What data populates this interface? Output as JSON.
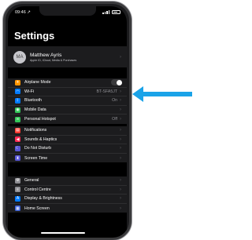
{
  "status": {
    "time": "09:46 ↗"
  },
  "title": "Settings",
  "profile": {
    "initials": "MA",
    "name": "Matthew Ayris",
    "subtitle": "Apple ID, iCloud, Media & Purchases"
  },
  "group1": [
    {
      "label": "Airplane Mode",
      "icon": "airplane-icon",
      "color": "#ff9500",
      "glyph": "✈",
      "toggle": true
    },
    {
      "label": "Wi-Fi",
      "icon": "wifi-icon",
      "color": "#007aff",
      "glyph": "◠",
      "value": "BT-SFA5JT"
    },
    {
      "label": "Bluetooth",
      "icon": "bluetooth-icon",
      "color": "#007aff",
      "glyph": "ᛒ",
      "value": "On"
    },
    {
      "label": "Mobile Data",
      "icon": "antenna-icon",
      "color": "#34c759",
      "glyph": "◉"
    },
    {
      "label": "Personal Hotspot",
      "icon": "hotspot-icon",
      "color": "#34c759",
      "glyph": "∞",
      "value": "Off"
    }
  ],
  "group2": [
    {
      "label": "Notifications",
      "icon": "bell-icon",
      "color": "#ff3b30",
      "glyph": "▤"
    },
    {
      "label": "Sounds & Haptics",
      "icon": "speaker-icon",
      "color": "#ff2d55",
      "glyph": "◀"
    },
    {
      "label": "Do Not Disturb",
      "icon": "moon-icon",
      "color": "#5856d6",
      "glyph": "☾"
    },
    {
      "label": "Screen Time",
      "icon": "hourglass-icon",
      "color": "#5856d6",
      "glyph": "⧗"
    }
  ],
  "group3": [
    {
      "label": "General",
      "icon": "gear-icon",
      "color": "#8e8e93",
      "glyph": "⚙"
    },
    {
      "label": "Control Centre",
      "icon": "switches-icon",
      "color": "#8e8e93",
      "glyph": "≡"
    },
    {
      "label": "Display & Brightness",
      "icon": "brightness-icon",
      "color": "#007aff",
      "glyph": "A"
    },
    {
      "label": "Home Screen",
      "icon": "grid-icon",
      "color": "#3a5fd6",
      "glyph": "▦"
    }
  ],
  "arrow_color": "#1aa3e8"
}
